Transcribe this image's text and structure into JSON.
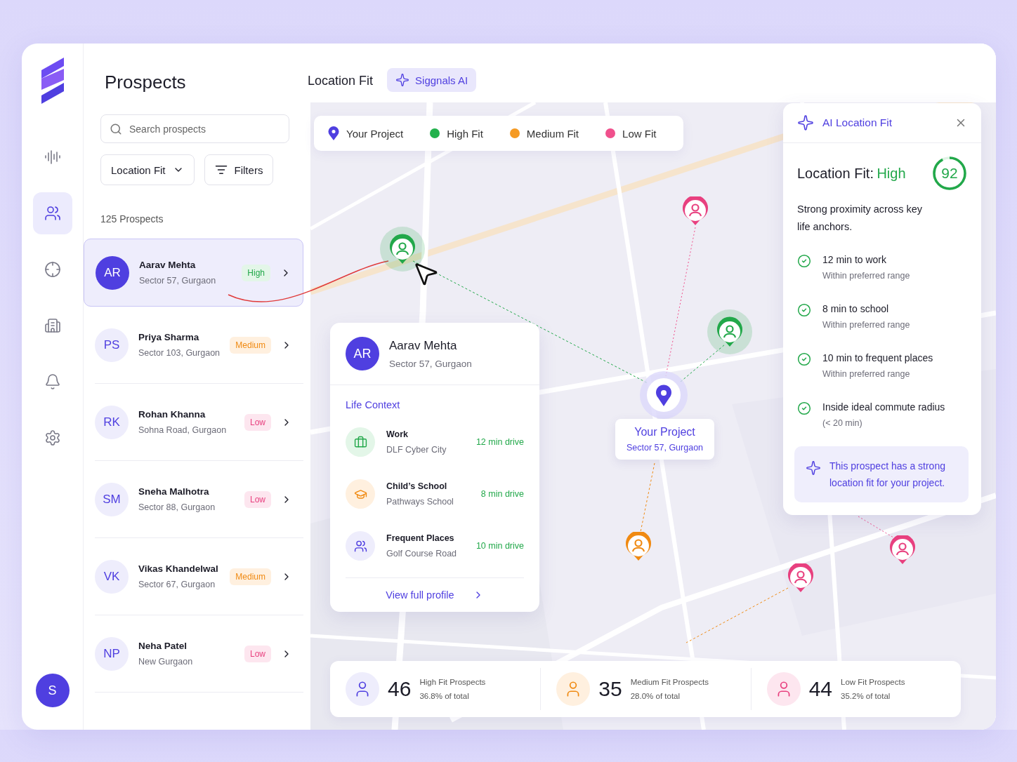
{
  "sidebar": {
    "nav": [
      {
        "selected": false
      },
      {
        "selected": true
      },
      {
        "selected": false
      },
      {
        "selected": false
      },
      {
        "selected": false
      },
      {
        "selected": false
      }
    ],
    "user_initial": "S"
  },
  "list": {
    "title": "Prospects",
    "search": {
      "placeholder": "Search prospects"
    },
    "sort": "Location Fit",
    "filters": "Filters",
    "count": "125 Prospects",
    "rows": [
      {
        "initials": "AR",
        "name": "Aarav Mehta",
        "area": "Sector 57, Gurgaon",
        "kind": "high",
        "fit_label": "High",
        "selected": true
      },
      {
        "initials": "PS",
        "name": "Priya Sharma",
        "area": "Sector 103, Gurgaon",
        "kind": "medium",
        "fit_label": "Medium",
        "selected": false
      },
      {
        "initials": "RK",
        "name": "Rohan Khanna",
        "area": "Sohna Road, Gurgaon",
        "kind": "low",
        "fit_label": "Low",
        "selected": false
      },
      {
        "initials": "SM",
        "name": "Sneha Malhotra",
        "area": "Sector 88, Gurgaon",
        "kind": "low",
        "fit_label": "Low",
        "selected": false
      },
      {
        "initials": "VK",
        "name": "Vikas Khandelwal",
        "area": "Sector 67, Gurgaon",
        "kind": "medium",
        "fit_label": "Medium",
        "selected": false
      },
      {
        "initials": "NP",
        "name": "Neha Patel",
        "area": "New Gurgaon",
        "kind": "low",
        "fit_label": "Low",
        "selected": false
      }
    ]
  },
  "header": {
    "title": "Location Fit",
    "ai_button": "Siggnals AI"
  },
  "legend": [
    {
      "kind": "project",
      "label": "Your Project",
      "color": "#4f3fe0"
    },
    {
      "kind": "dot",
      "label": "High Fit",
      "color": "#22b14c"
    },
    {
      "kind": "dot",
      "label": "Medium Fit",
      "color": "#f59a23"
    },
    {
      "kind": "dot",
      "label": "Low Fit",
      "color": "#f0508c"
    }
  ],
  "map": {
    "pins": [
      {
        "kind": "high",
        "highlighted": true
      },
      {
        "kind": "low",
        "highlighted": false
      },
      {
        "kind": "high",
        "highlighted": true
      },
      {
        "kind": "medium",
        "highlighted": false
      },
      {
        "kind": "low",
        "highlighted": false
      },
      {
        "kind": "low",
        "highlighted": false
      }
    ],
    "project": {
      "title": "Your Project",
      "area": "Sector 57, Gurgaon"
    }
  },
  "popup": {
    "initials": "AR",
    "name": "Aarav Mehta",
    "area": "Sector 57, Gurgaon",
    "section": "Life Context",
    "items": [
      {
        "kind": "work",
        "title": "Work",
        "place": "DLF Cyber City",
        "drive": "12 min drive"
      },
      {
        "kind": "school",
        "title": "Child’s School",
        "place": "Pathways School",
        "drive": "8 min drive"
      },
      {
        "kind": "places",
        "title": "Frequent Places",
        "place": "Golf Course Road",
        "drive": "10 min drive"
      }
    ],
    "link": "View full profile"
  },
  "ai_panel": {
    "title": "AI Location Fit",
    "fit_label": "Location Fit:",
    "fit_value": "High",
    "score": "92",
    "summary": "Strong proximity across key life anchors.",
    "checks": [
      {
        "title": "12 min to work",
        "note": "Within preferred range"
      },
      {
        "title": "8 min to school",
        "note": "Within preferred range"
      },
      {
        "title": "10 min to frequent places",
        "note": "Within preferred range"
      },
      {
        "title": "Inside ideal commute radius",
        "note": "(< 20 min)"
      }
    ],
    "callout": "This prospect has a strong location fit for your project."
  },
  "stats": [
    {
      "kind": "high",
      "value": "46",
      "label": "High Fit Prospects",
      "share": "36.8% of total"
    },
    {
      "kind": "medium",
      "value": "35",
      "label": "Medium Fit Prospects",
      "share": "28.0% of total"
    },
    {
      "kind": "low",
      "value": "44",
      "label": "Low Fit Prospects",
      "share": "35.2% of total"
    }
  ]
}
